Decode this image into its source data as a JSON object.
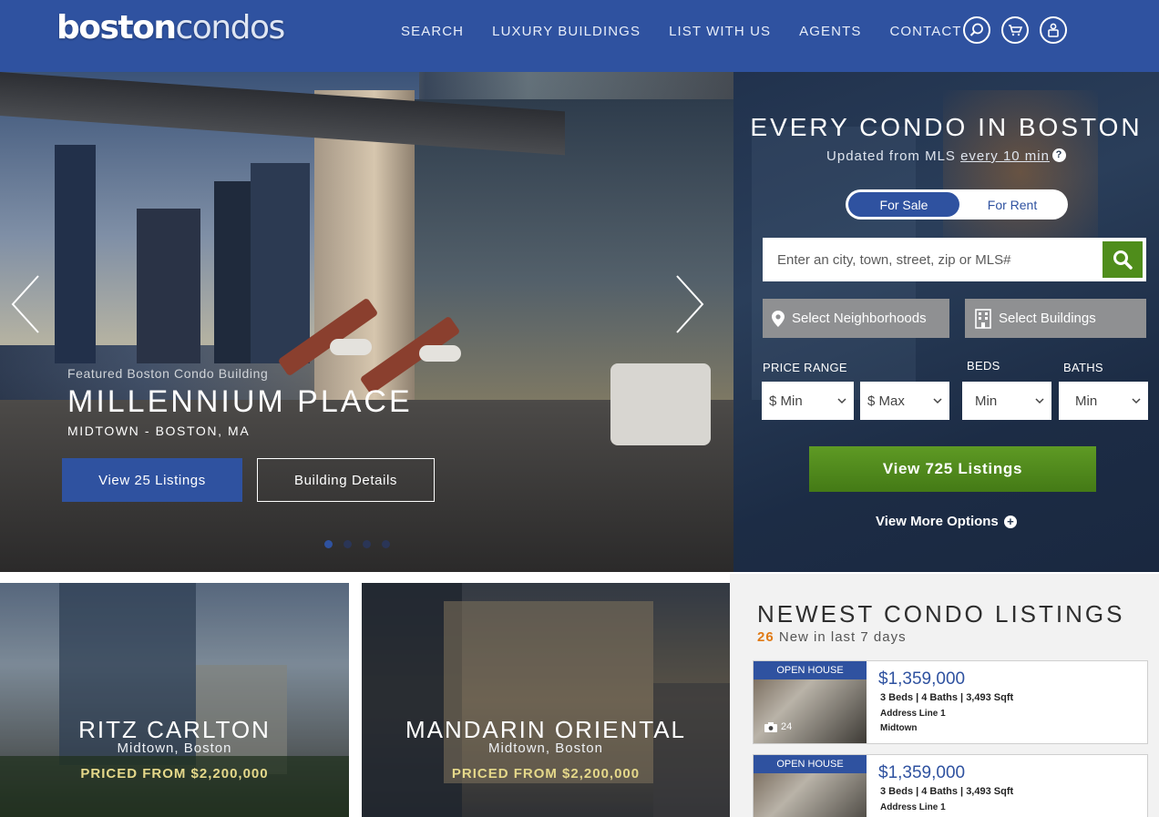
{
  "header": {
    "logo_bold": "boston",
    "logo_light": "condos",
    "nav": [
      "SEARCH",
      "LUXURY BUILDINGS",
      "LIST WITH US",
      "AGENTS",
      "CONTACT"
    ],
    "icons": [
      "search-icon",
      "cart-icon",
      "user-icon"
    ],
    "bg_color": "#2f52a0"
  },
  "hero": {
    "subtitle": "Featured Boston Condo Building",
    "title": "MILLENNIUM PLACE",
    "location": "MIDTOWN - BOSTON, MA",
    "listings_button": "View 25 Listings",
    "details_button": "Building Details",
    "slide_count": 4,
    "active_slide": 1
  },
  "search": {
    "title": "EVERY CONDO IN BOSTON",
    "subtitle_prefix": "Updated from MLS",
    "subtitle_link": "every 10 min",
    "toggle_sale": "For Sale",
    "toggle_rent": "For Rent",
    "placeholder": "Enter an city, town, street, zip or MLS#",
    "neighborhoods_button": "Select Neighborhoods",
    "buildings_button": "Select Buildings",
    "price_label": "PRICE RANGE",
    "beds_label": "BEDS",
    "baths_label": "BATHS",
    "price_min": "$ Min",
    "price_max": "$ Max",
    "beds_min": "Min",
    "baths_min": "Min",
    "view_button": "View 725 Listings",
    "more_options": "View More Options",
    "accent_green": "#4f8d1b"
  },
  "cards": [
    {
      "title": "RITZ CARLTON",
      "location": "Midtown, Boston",
      "price": "PRICED FROM $2,200,000"
    },
    {
      "title": "MANDARIN ORIENTAL",
      "location": "Midtown, Boston",
      "price": "PRICED FROM $2,200,000"
    }
  ],
  "newest": {
    "title": "NEWEST CONDO LISTINGS",
    "count": "26",
    "count_text": "New in last 7 days",
    "listings": [
      {
        "badge": "OPEN HOUSE",
        "photos": "24",
        "price": "$1,359,000",
        "specs": "3 Beds | 4 Baths | 3,493 Sqft",
        "address": "Address Line 1",
        "area": "Midtown"
      },
      {
        "badge": "OPEN HOUSE",
        "photos": "",
        "price": "$1,359,000",
        "specs": "3 Beds | 4 Baths | 3,493 Sqft",
        "address": "Address Line 1",
        "area": ""
      }
    ]
  }
}
